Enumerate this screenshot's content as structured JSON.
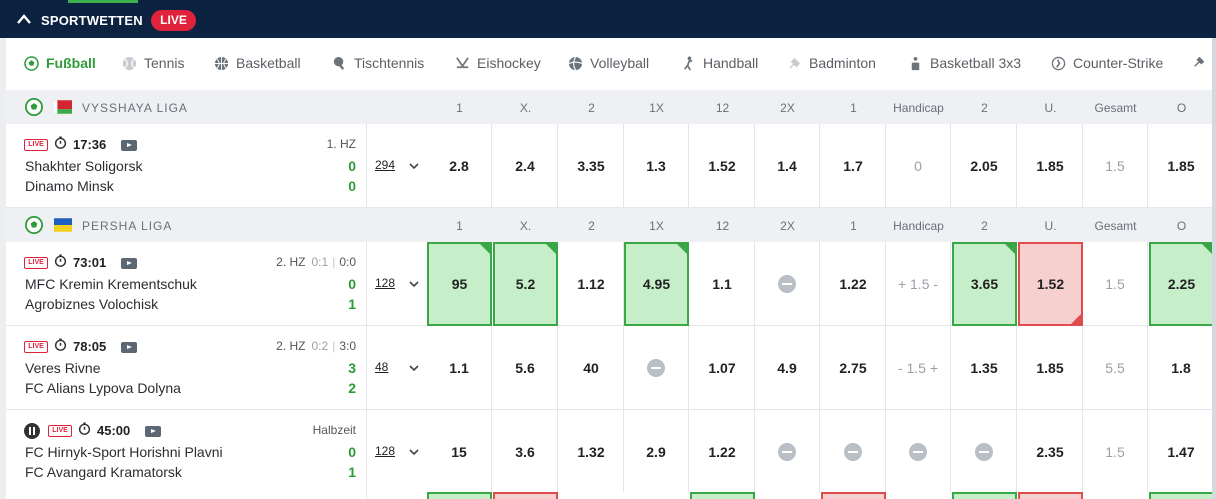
{
  "header": {
    "title": "SPORTWETTEN",
    "live_badge": "LIVE"
  },
  "sports": [
    {
      "label": "Fußball",
      "icon": "football-icon",
      "active": true
    },
    {
      "label": "Tennis",
      "icon": "tennis-ball-icon"
    },
    {
      "label": "Basketball",
      "icon": "basketball-icon"
    },
    {
      "label": "Tischtennis",
      "icon": "table-tennis-icon"
    },
    {
      "label": "Eishockey",
      "icon": "ice-hockey-icon"
    },
    {
      "label": "Volleyball",
      "icon": "volleyball-icon"
    },
    {
      "label": "Handball",
      "icon": "handball-icon"
    },
    {
      "label": "Badminton",
      "icon": "badminton-icon"
    },
    {
      "label": "Basketball 3x3",
      "icon": "basketball-3x3-icon"
    },
    {
      "label": "Counter-Strike",
      "icon": "counter-strike-icon"
    }
  ],
  "market_columns": [
    "1",
    "X.",
    "2",
    "1X",
    "12",
    "2X",
    "1",
    "Handicap",
    "2",
    "U.",
    "Gesamt",
    "O"
  ],
  "colors": {
    "accent": "#3cb04a",
    "navy": "#0b2340",
    "live": "#e0233a",
    "up": "#39a746",
    "down": "#e04b4b"
  },
  "leagues": [
    {
      "name": "VYSSHAYA LIGA",
      "flag": "belarus-flag",
      "matches": [
        {
          "live": "LIVE",
          "time": "17:36",
          "period": "1. HZ",
          "halftime": "",
          "score_now": "",
          "paused": false,
          "home": "Shakhter Soligorsk",
          "away": "Dinamo Minsk",
          "home_score": "0",
          "away_score": "0",
          "more": "294",
          "odds": [
            {
              "v": "2.8"
            },
            {
              "v": "2.4"
            },
            {
              "v": "3.35"
            },
            {
              "v": "1.3"
            },
            {
              "v": "1.52"
            },
            {
              "v": "1.4"
            },
            {
              "v": "1.7"
            },
            {
              "v": "0",
              "d": 1
            },
            {
              "v": "2.05"
            },
            {
              "v": "1.85"
            },
            {
              "v": "1.5",
              "d": 1
            },
            {
              "v": "1.85"
            }
          ]
        }
      ]
    },
    {
      "name": "PERSHA LIGA",
      "flag": "ukraine-flag",
      "matches": [
        {
          "live": "LIVE",
          "time": "73:01",
          "period": "2. HZ",
          "halftime": "0:1",
          "score_now": "0:0",
          "paused": false,
          "home": "MFC Kremin Krementschuk",
          "away": "Agrobiznes Volochisk",
          "home_score": "0",
          "away_score": "1",
          "more": "128",
          "odds": [
            {
              "v": "95",
              "s": "up"
            },
            {
              "v": "5.2",
              "s": "up"
            },
            {
              "v": "1.12"
            },
            {
              "v": "4.95",
              "s": "up"
            },
            {
              "v": "1.1"
            },
            {
              "v": "",
              "lock": 1
            },
            {
              "v": "1.22"
            },
            {
              "v": "+ 1.5 -",
              "d": 1
            },
            {
              "v": "3.65",
              "s": "up"
            },
            {
              "v": "1.52",
              "s": "down"
            },
            {
              "v": "1.5",
              "d": 1
            },
            {
              "v": "2.25",
              "s": "up"
            }
          ]
        },
        {
          "live": "LIVE",
          "time": "78:05",
          "period": "2. HZ",
          "halftime": "0:2",
          "score_now": "3:0",
          "paused": false,
          "home": "Veres Rivne",
          "away": "FC Alians Lypova Dolyna",
          "home_score": "3",
          "away_score": "2",
          "more": "48",
          "odds": [
            {
              "v": "1.1"
            },
            {
              "v": "5.6"
            },
            {
              "v": "40"
            },
            {
              "v": "",
              "lock": 1
            },
            {
              "v": "1.07"
            },
            {
              "v": "4.9"
            },
            {
              "v": "2.75"
            },
            {
              "v": "- 1.5 +",
              "d": 1
            },
            {
              "v": "1.35"
            },
            {
              "v": "1.85"
            },
            {
              "v": "5.5",
              "d": 1
            },
            {
              "v": "1.8"
            }
          ]
        },
        {
          "live": "LIVE",
          "time": "45:00",
          "period": "Halbzeit",
          "halftime": "",
          "score_now": "",
          "paused": true,
          "home": "FC Hirnyk-Sport Horishni Plavni",
          "away": "FC Avangard Kramatorsk",
          "home_score": "0",
          "away_score": "1",
          "more": "128",
          "odds": [
            {
              "v": "15"
            },
            {
              "v": "3.6"
            },
            {
              "v": "1.32"
            },
            {
              "v": "2.9"
            },
            {
              "v": "1.22"
            },
            {
              "v": "",
              "lock": 1
            },
            {
              "v": "",
              "lock": 1
            },
            {
              "v": "",
              "lock": 1
            },
            {
              "v": "",
              "lock": 1
            },
            {
              "v": "2.35"
            },
            {
              "v": "1.5",
              "d": 1
            },
            {
              "v": "1.47"
            }
          ]
        }
      ]
    }
  ]
}
